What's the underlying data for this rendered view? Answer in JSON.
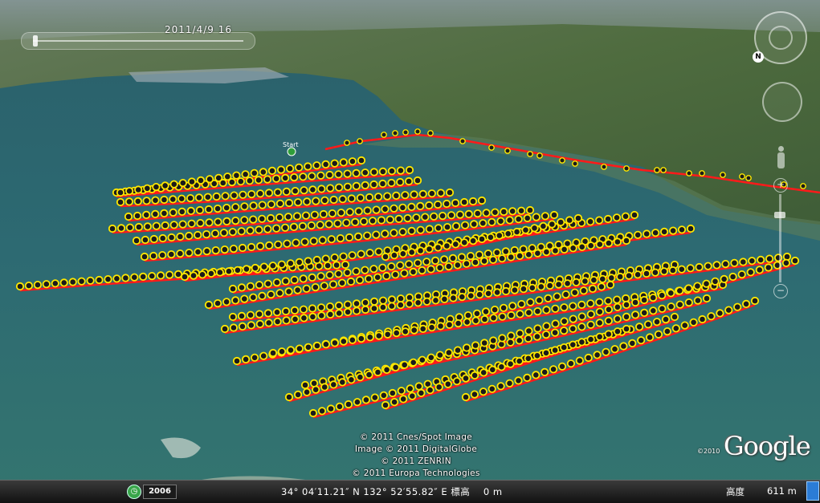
{
  "view": {
    "time_label": "2011/4/9 16",
    "track_start_label": "Start"
  },
  "credits": [
    "© 2011 Cnes/Spot Image",
    "Image © 2011 DigitalGlobe",
    "© 2011 ZENRIN",
    "© 2011 Europa Technologies"
  ],
  "brand": {
    "copyright": "©2010",
    "logo": "Google"
  },
  "status_bar": {
    "year": "2006",
    "coordinates": "34° 04′11.21″ N 132° 52′55.82″ E 標高    0 m",
    "altitude_label": "高度",
    "altitude_value": "611 m"
  },
  "navigation": {
    "compass_letter": "N",
    "zoom_in": "+",
    "zoom_out": "−"
  },
  "icons": {
    "history": "clock-icon",
    "start": "start-flag-icon",
    "compass": "compass-icon",
    "look": "look-joystick-icon",
    "pegman": "street-view-icon"
  },
  "colors": {
    "track": "#ff1a1a",
    "marker_fill": "#1a1a1a",
    "marker_ring": "#ffe800",
    "water": "#2f6b72",
    "land": "#4c6a3c"
  }
}
